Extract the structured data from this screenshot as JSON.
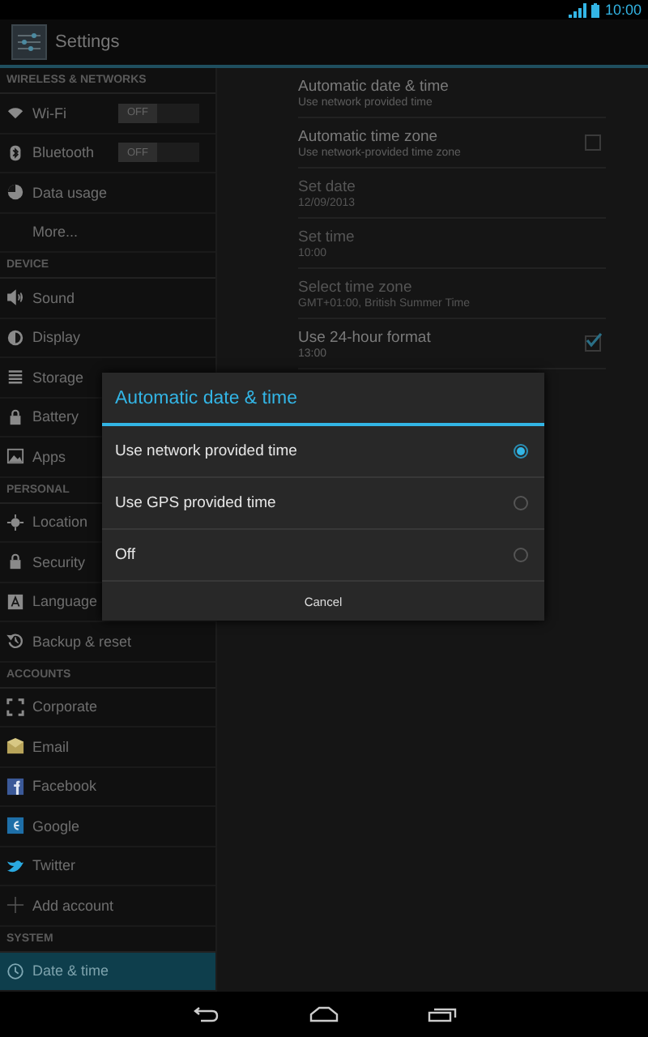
{
  "status_bar": {
    "time": "10:00"
  },
  "action_bar": {
    "title": "Settings"
  },
  "sidebar": {
    "sections": [
      {
        "header": "WIRELESS & NETWORKS",
        "items": [
          {
            "label": "Wi-Fi",
            "selected": false,
            "toggle": {
              "label": "OFF",
              "on": false
            }
          },
          {
            "label": "Bluetooth",
            "selected": false,
            "toggle": {
              "label": "OFF",
              "on": false
            }
          },
          {
            "label": "Data usage",
            "selected": false
          },
          {
            "label": "More...",
            "selected": false
          }
        ]
      },
      {
        "header": "DEVICE",
        "items": [
          {
            "label": "Sound",
            "selected": false
          },
          {
            "label": "Display",
            "selected": false
          },
          {
            "label": "Storage",
            "selected": false
          },
          {
            "label": "Battery",
            "selected": false
          },
          {
            "label": "Apps",
            "selected": false
          }
        ]
      },
      {
        "header": "PERSONAL",
        "items": [
          {
            "label": "Location",
            "selected": false
          },
          {
            "label": "Security",
            "selected": false
          },
          {
            "label": "Language",
            "selected": false
          },
          {
            "label": "Backup & reset",
            "selected": false
          }
        ]
      },
      {
        "header": "ACCOUNTS",
        "items": [
          {
            "label": "Corporate",
            "selected": false
          },
          {
            "label": "Email",
            "selected": false
          },
          {
            "label": "Facebook",
            "selected": false
          },
          {
            "label": "Google",
            "selected": false
          },
          {
            "label": "Twitter",
            "selected": false
          },
          {
            "label": "Add account",
            "selected": false
          }
        ]
      },
      {
        "header": "SYSTEM",
        "items": [
          {
            "label": "Date & time",
            "selected": true
          }
        ]
      }
    ]
  },
  "settings": {
    "items": [
      {
        "title": "Automatic date & time",
        "summary": "Use network provided time",
        "disabled": false
      },
      {
        "title": "Automatic time zone",
        "summary": "Use network-provided time zone",
        "disabled": false,
        "checked": false
      },
      {
        "title": "Set date",
        "summary": "12/09/2013",
        "disabled": true
      },
      {
        "title": "Set time",
        "summary": "10:00",
        "disabled": true
      },
      {
        "title": "Select time zone",
        "summary": "GMT+01:00, British Summer Time",
        "disabled": true
      },
      {
        "title": "Use 24-hour format",
        "summary": "13:00",
        "disabled": false,
        "checked": true
      }
    ]
  },
  "dialog": {
    "title": "Automatic date & time",
    "options": [
      {
        "label": "Use network provided time",
        "selected": true
      },
      {
        "label": "Use GPS provided time",
        "selected": false
      },
      {
        "label": "Off",
        "selected": false
      }
    ],
    "button": "Cancel"
  }
}
